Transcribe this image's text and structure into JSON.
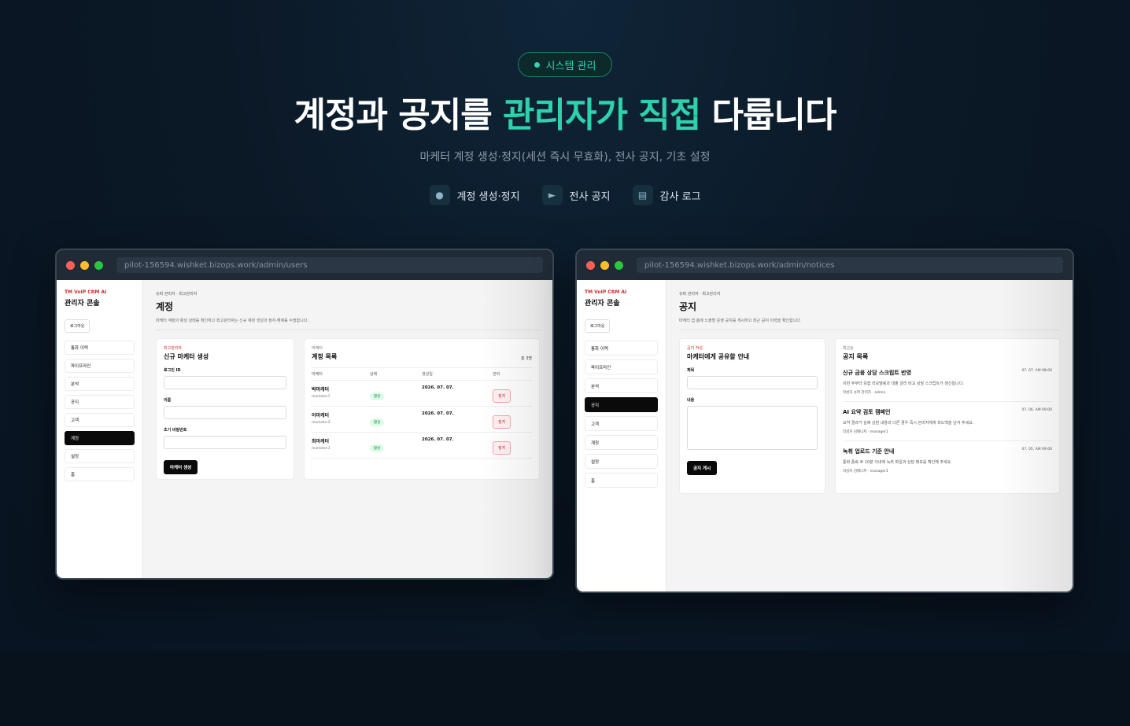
{
  "header": {
    "pill": "시스템 관리",
    "headline_before": "계정과 공지를 ",
    "headline_accent": "관리자가 직접",
    "headline_after": " 다룹니다",
    "subline": "마케터 계정 생성·정지(세션 즉시 무효화), 전사 공지, 기초 설정",
    "features": [
      {
        "icon": "user-icon",
        "label": "계정 생성·정지"
      },
      {
        "icon": "megaphone-icon",
        "label": "전사 공지"
      },
      {
        "icon": "document-icon",
        "label": "감사 로그"
      }
    ]
  },
  "colors": {
    "accent": "#2fd1ad",
    "brand_red": "#d1282f",
    "background": "#0b1826"
  },
  "users_window": {
    "url": "pilot-156594.wishket.bizops.work/admin/users",
    "brand": "TM VoIP CRM AI",
    "console": "관리자 콘솔",
    "logout": "로그아웃",
    "nav": [
      "통화 이력",
      "파이프라인",
      "분석",
      "공지",
      "고객",
      "계정",
      "설정",
      "홈"
    ],
    "active_nav": "계정",
    "crumb": "슈퍼 관리자 · 최고관리자",
    "title": "계정",
    "desc": "마케터 계정의 활성 상태를 확인하고 최고관리자는 신규 계정 생성과 정지·해제를 수행합니다.",
    "create": {
      "eyebrow": "최고관리자",
      "title": "신규 마케터 생성",
      "login_label": "로그인 ID",
      "name_label": "이름",
      "password_label": "초기 비밀번호",
      "submit": "마케터 생성"
    },
    "list": {
      "eyebrow": "마케터",
      "title": "계정 목록",
      "total": "총 3명",
      "columns": [
        "마케터",
        "상태",
        "생성일",
        "관리"
      ],
      "rows": [
        {
          "name": "박마케터",
          "id": "marketer1",
          "status": "활성",
          "date": "2026. 07. 07.",
          "action": "정지"
        },
        {
          "name": "이마케터",
          "id": "marketer2",
          "status": "활성",
          "date": "2026. 07. 07.",
          "action": "정지"
        },
        {
          "name": "최마케터",
          "id": "marketer3",
          "status": "활성",
          "date": "2026. 07. 07.",
          "action": "정지"
        }
      ]
    }
  },
  "notices_window": {
    "url": "pilot-156594.wishket.bizops.work/admin/notices",
    "brand": "TM VoIP CRM AI",
    "console": "관리자 콘솔",
    "logout": "로그아웃",
    "nav": [
      "통화 이력",
      "파이프라인",
      "분석",
      "공지",
      "고객",
      "계정",
      "설정",
      "홈"
    ],
    "active_nav": "공지",
    "crumb": "슈퍼 관리자 · 최고관리자",
    "title": "공지",
    "desc": "마케터 앱 홈에 노출할 운영 공지를 게시하고 최근 공지 이력을 확인합니다.",
    "compose": {
      "eyebrow": "공지 작성",
      "title": "마케터에게 공유할 안내",
      "title_label": "제목",
      "body_label": "내용",
      "submit": "공지 게시"
    },
    "list": {
      "eyebrow": "최근순",
      "title": "공지 목록",
      "items": [
        {
          "title": "신규 금융 상담 스크립트 반영",
          "time": "07. 07. AM 08:00",
          "body": "이번 주부터 보험 리모델링과 대출 금리 비교 상담 스크립트가 갱신됩니다.",
          "meta": "작성자 슈퍼 관리자 · admin"
        },
        {
          "title": "AI 요약 검토 캠페인",
          "time": "07. 06. AM 09:00",
          "body": "요약 결과가 실제 상담 내용과 다른 경우 즉시 관리자에게 피드백을 남겨 주세요.",
          "meta": "작성자 김매니저 · manager1"
        },
        {
          "title": "녹취 업로드 기준 안내",
          "time": "07. 05. AM 09:00",
          "body": "통화 종료 후 10분 이내에 녹취 파일과 상담 메모를 확인해 주세요.",
          "meta": "작성자 김매니저 · manager1"
        }
      ]
    }
  }
}
